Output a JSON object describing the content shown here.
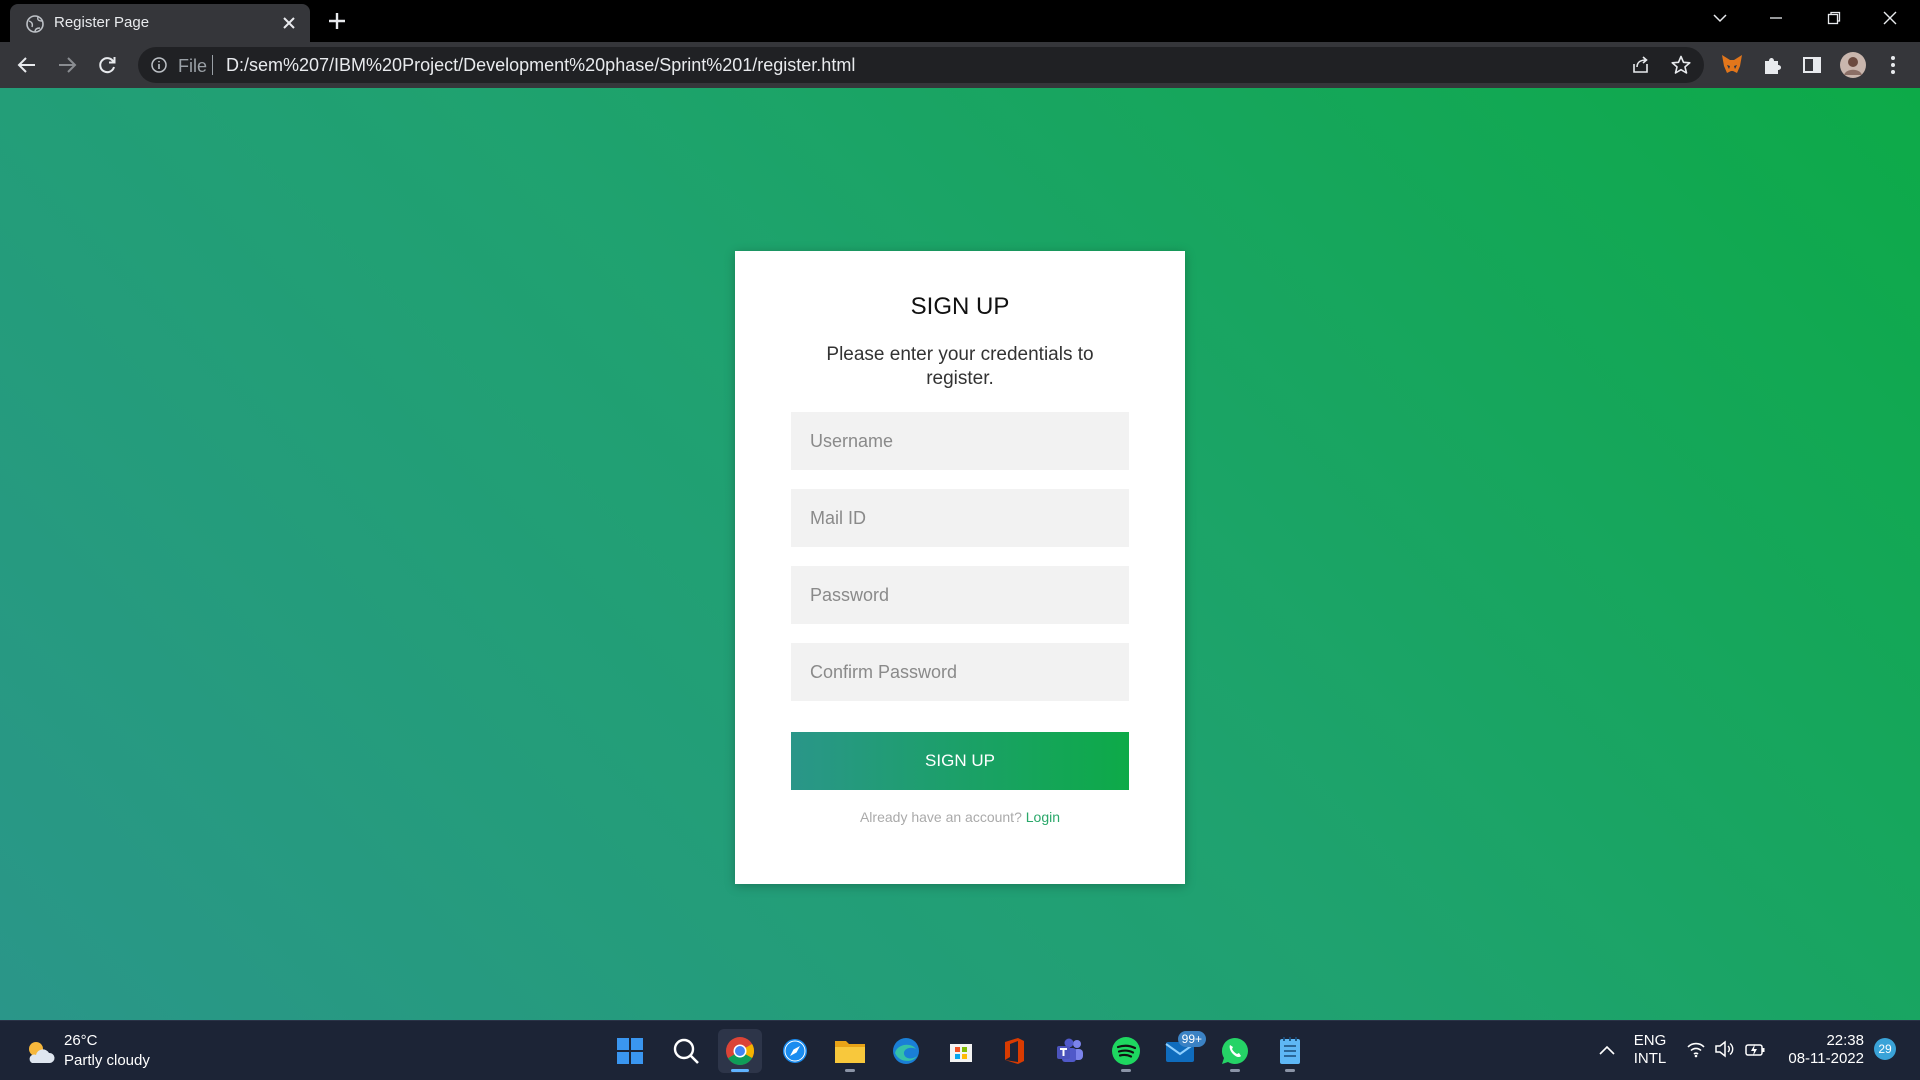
{
  "browser": {
    "tab_title": "Register Page",
    "address_scheme": "File",
    "address_url": "D:/sem%207/IBM%20Project/Development%20phase/Sprint%201/register.html"
  },
  "form": {
    "title": "SIGN UP",
    "description": "Please enter your credentials to register.",
    "username_placeholder": "Username",
    "mail_placeholder": "Mail ID",
    "password_placeholder": "Password",
    "confirm_placeholder": "Confirm Password",
    "submit_label": "SIGN UP",
    "switch_text": "Already have an account? ",
    "switch_link": "Login"
  },
  "taskbar": {
    "weather_temp": "26°C",
    "weather_condition": "Partly cloudy",
    "mail_badge": "99+",
    "lang_line1": "ENG",
    "lang_line2": "INTL",
    "time": "22:38",
    "date": "08-11-2022",
    "notification_count": "29"
  },
  "colors": {
    "gradient_start": "#2a9689",
    "gradient_end": "#0daa48",
    "login_link": "#2aa86a"
  }
}
